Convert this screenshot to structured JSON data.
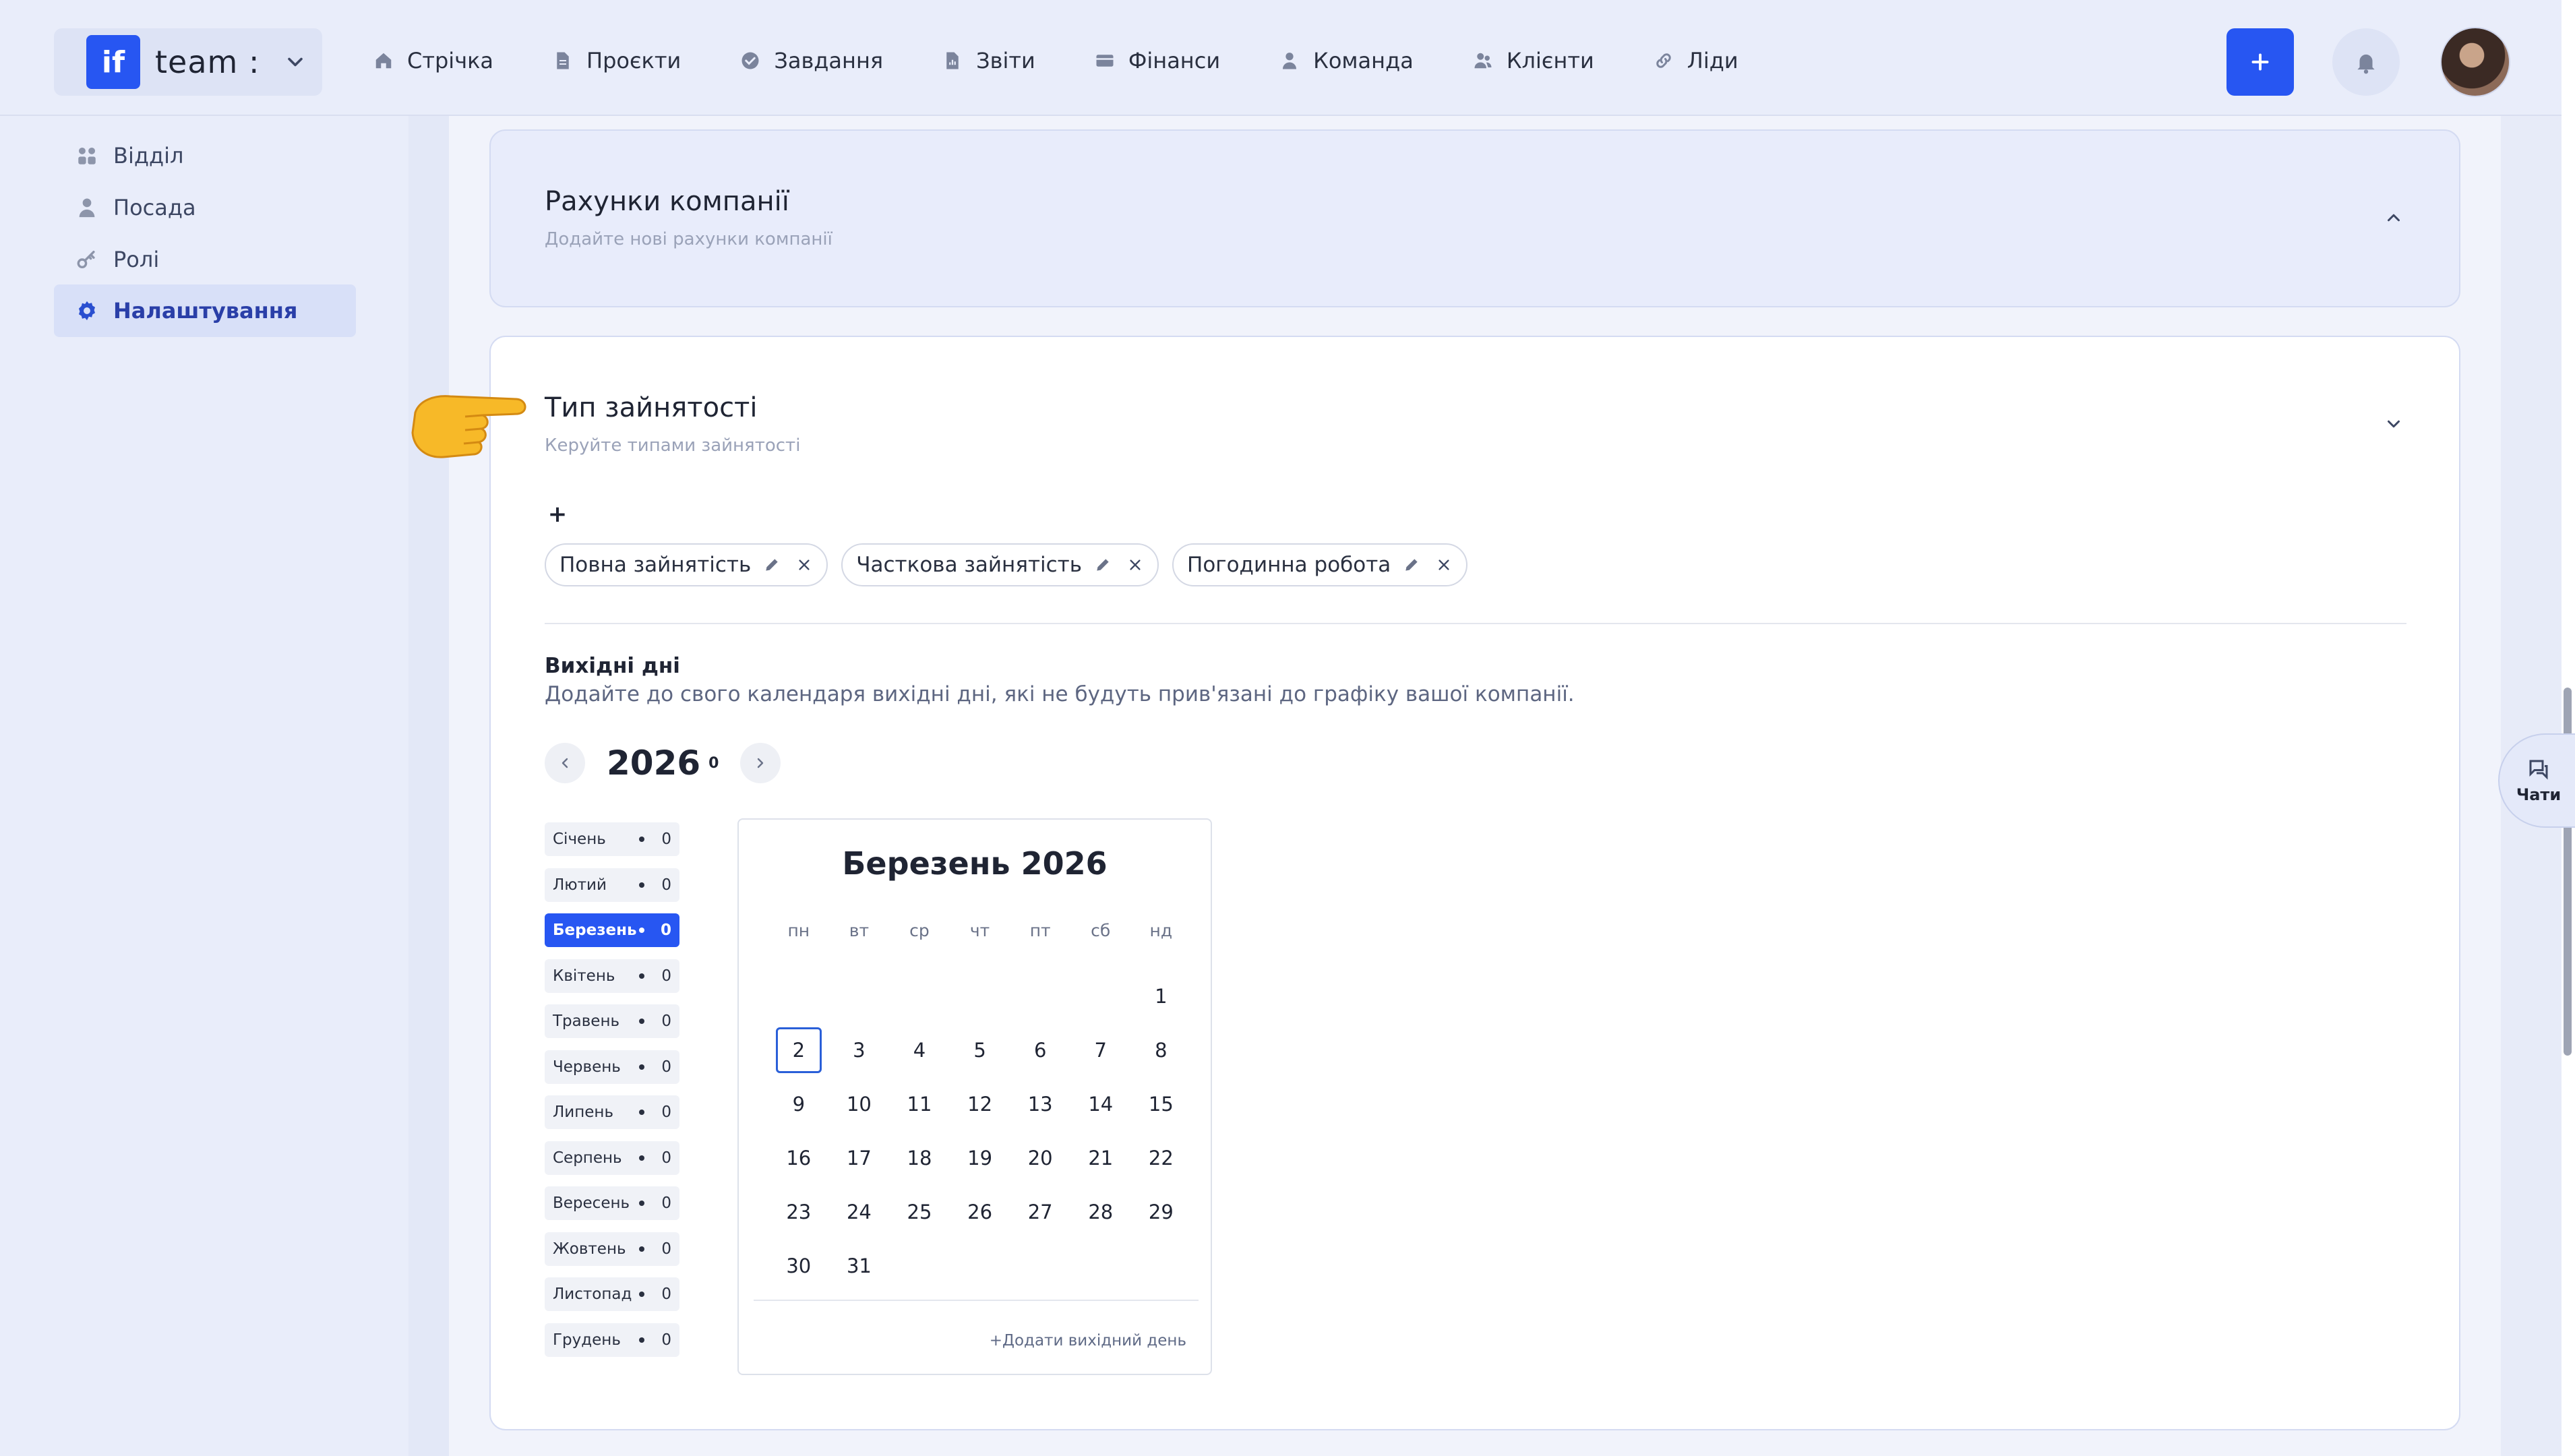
{
  "brand": {
    "logo": "if",
    "name": "team :"
  },
  "nav": [
    {
      "label": "Стрічка",
      "icon": "home-icon"
    },
    {
      "label": "Проєкти",
      "icon": "document-icon"
    },
    {
      "label": "Завдання",
      "icon": "check-circle-icon"
    },
    {
      "label": "Звіти",
      "icon": "report-icon"
    },
    {
      "label": "Фінанси",
      "icon": "wallet-icon"
    },
    {
      "label": "Команда",
      "icon": "person-icon"
    },
    {
      "label": "Клієнти",
      "icon": "people-icon"
    },
    {
      "label": "Ліди",
      "icon": "link-icon"
    }
  ],
  "header_actions": {
    "add": "+"
  },
  "sidebar": {
    "items": [
      {
        "label": "Відділ",
        "icon": "department-icon"
      },
      {
        "label": "Посада",
        "icon": "person-icon"
      },
      {
        "label": "Ролі",
        "icon": "key-icon"
      },
      {
        "label": "Налаштування",
        "icon": "gear-icon",
        "active": true
      }
    ]
  },
  "accounts_card": {
    "title": "Рахунки компанії",
    "subtitle": "Додайте нові рахунки компанії"
  },
  "employment_card": {
    "title": "Тип зайнятості",
    "subtitle": "Керуйте типами зайнятості",
    "add_label": "+",
    "types": [
      "Повна зайнятість",
      "Часткова зайнятість",
      "Погодинна робота"
    ]
  },
  "holidays": {
    "title": "Вихідні дні",
    "description": "Додайте до свого календаря вихідні дні, які не будуть прив'язані до графіку вашої компанії.",
    "year": "2026",
    "year_count": "0",
    "months": [
      {
        "name": "Січень",
        "count": "0"
      },
      {
        "name": "Лютий",
        "count": "0"
      },
      {
        "name": "Березень",
        "count": "0",
        "active": true
      },
      {
        "name": "Квітень",
        "count": "0"
      },
      {
        "name": "Травень",
        "count": "0"
      },
      {
        "name": "Червень",
        "count": "0"
      },
      {
        "name": "Липень",
        "count": "0"
      },
      {
        "name": "Серпень",
        "count": "0"
      },
      {
        "name": "Вересень",
        "count": "0"
      },
      {
        "name": "Жовтень",
        "count": "0"
      },
      {
        "name": "Листопад",
        "count": "0"
      },
      {
        "name": "Грудень",
        "count": "0"
      }
    ],
    "calendar": {
      "title": "Березень 2026",
      "weekdays": [
        "пн",
        "вт",
        "ср",
        "чт",
        "пт",
        "сб",
        "нд"
      ],
      "first_weekday_index": 6,
      "days_in_month": 31,
      "today": 2,
      "add_label": "+Додати вихідний день"
    }
  },
  "chat": {
    "label": "Чати"
  },
  "colors": {
    "accent": "#2756f2",
    "sidebar_bg": "#e9edfa",
    "today_border": "#2a5fd8"
  }
}
